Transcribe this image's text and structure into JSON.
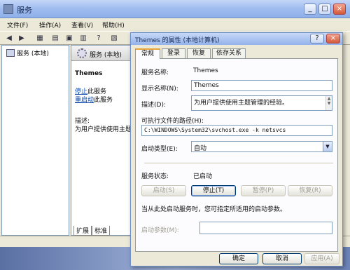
{
  "services_window": {
    "title": "服务",
    "menu": [
      "文件(F)",
      "操作(A)",
      "查看(V)",
      "帮助(H)"
    ],
    "tree_root": "服务 (本地)",
    "detail_header": "服务 (本地)",
    "selected_service": "Themes",
    "stop_link": "停止",
    "stop_suffix": "此服务",
    "restart_link": "重启动",
    "restart_suffix": "此服务",
    "desc_label": "描述:",
    "desc_text": "为用户提供使用主题",
    "bottom_tabs": [
      "扩展",
      "标准"
    ]
  },
  "dialog": {
    "title": "Themes 的属性 (本地计算机)",
    "help_glyph": "?",
    "close_glyph": "×",
    "tabs": [
      "常规",
      "登录",
      "恢复",
      "依存关系"
    ],
    "service_name_label": "服务名称:",
    "service_name_value": "Themes",
    "display_name_label": "显示名称(N):",
    "display_name_value": "Themes",
    "description_label": "描述(D):",
    "description_value": "为用户提供使用主题管理的经验。",
    "exe_path_label": "可执行文件的路径(H):",
    "exe_path_value": "C:\\WINDOWS\\System32\\svchost.exe -k netsvcs",
    "startup_type_label": "启动类型(E):",
    "startup_type_value": "自动",
    "status_label": "服务状态:",
    "status_value": "已启动",
    "buttons": {
      "start": "启动(S)",
      "stop": "停止(T)",
      "pause": "暂停(P)",
      "resume": "恢复(R)"
    },
    "hint": "当从此处启动服务时，您可指定所适用的启动参数。",
    "params_label": "启动参数(M):",
    "ok": "确定",
    "cancel": "取消",
    "apply": "应用(A)"
  }
}
